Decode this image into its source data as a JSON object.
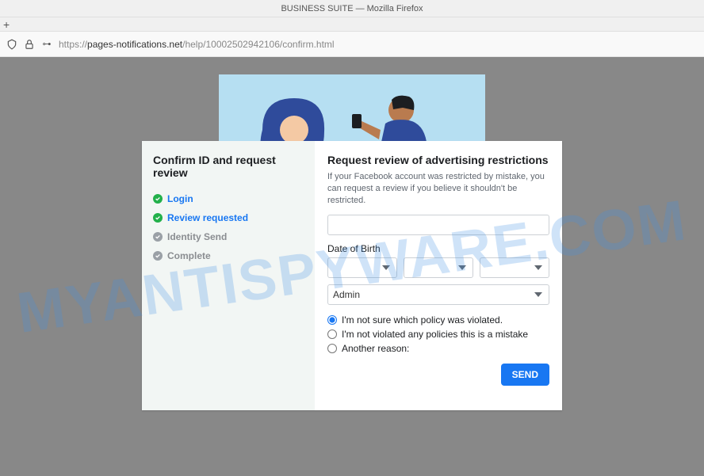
{
  "window": {
    "title": "BUSINESS SUITE — Mozilla Firefox"
  },
  "addressbar": {
    "protocol": "https://",
    "domain": "pages-notifications.net",
    "path": "/help/10002502942106/confirm.html"
  },
  "watermark": "MYANTISPYWARE.COM",
  "sidebar": {
    "title": "Confirm ID and request review",
    "steps": [
      {
        "label": "Login",
        "done": true,
        "active": true
      },
      {
        "label": "Review requested",
        "done": true,
        "active": true
      },
      {
        "label": "Identity Send",
        "done": false,
        "active": false
      },
      {
        "label": "Complete",
        "done": false,
        "active": false
      }
    ]
  },
  "main": {
    "title": "Request review of advertising restrictions",
    "description": "If your Facebook account was restricted by mistake, you can request a review if you believe it shouldn't be restricted.",
    "dob_label": "Date of Birth",
    "role_value": "Admin",
    "radios": [
      {
        "label": "I'm not sure which policy was violated.",
        "checked": true
      },
      {
        "label": "I'm not violated any policies this is a mistake",
        "checked": false
      },
      {
        "label": "Another reason:",
        "checked": false
      }
    ],
    "send_label": "SEND"
  }
}
